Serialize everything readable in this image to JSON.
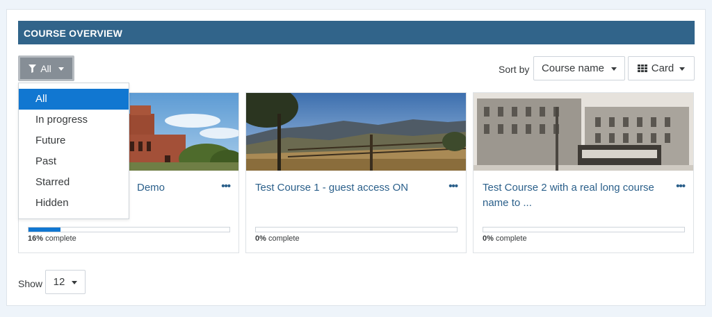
{
  "block": {
    "title": "COURSE OVERVIEW"
  },
  "filter": {
    "selected": "All",
    "options": [
      "All",
      "In progress",
      "Future",
      "Past",
      "Starred",
      "Hidden"
    ]
  },
  "sort": {
    "label": "Sort by",
    "selected": "Course name"
  },
  "view": {
    "selected": "Card"
  },
  "courses": [
    {
      "title": "Demo",
      "progress_percent": "16%",
      "progress_suffix": " complete",
      "progress_value": 16
    },
    {
      "title": "Test Course 1 - guest access ON",
      "progress_percent": "0%",
      "progress_suffix": " complete",
      "progress_value": 0
    },
    {
      "title": "Test Course 2 with a real long course name to ...",
      "progress_percent": "0%",
      "progress_suffix": " complete",
      "progress_value": 0
    }
  ],
  "menu_glyph": "•••",
  "paging": {
    "label": "Show",
    "selected": "12"
  },
  "colors": {
    "header": "#31648a",
    "accent": "#1177d1",
    "link": "#2a5f8a"
  }
}
